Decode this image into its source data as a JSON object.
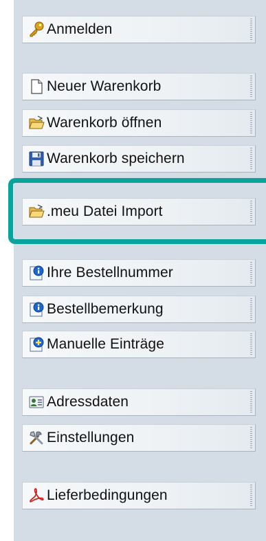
{
  "menu": {
    "login": "Anmelden",
    "new_cart": "Neuer Warenkorb",
    "open_cart": "Warenkorb öffnen",
    "save_cart": "Warenkorb speichern",
    "meu_import": ".meu Datei Import",
    "order_number": "Ihre Bestellnummer",
    "order_note": "Bestellbemerkung",
    "manual_entries": "Manuelle Einträge",
    "address": "Adressdaten",
    "settings": "Einstellungen",
    "terms": "Lieferbedingungen"
  },
  "colors": {
    "panel": "#d4dde6",
    "highlight": "#0aa39a"
  },
  "icons": [
    "key-icon",
    "document-icon",
    "folder-open-icon",
    "floppy-disk-icon",
    "folder-open-icon",
    "info-badge-icon",
    "info-badge-icon",
    "add-badge-icon",
    "contact-card-icon",
    "tools-icon",
    "pdf-icon"
  ]
}
